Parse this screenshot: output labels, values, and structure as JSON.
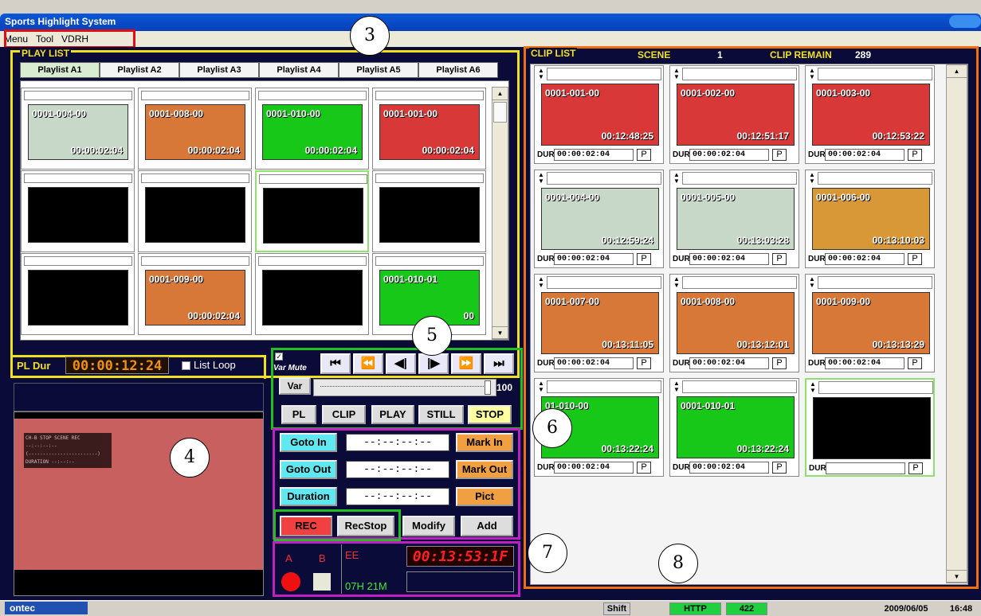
{
  "window": {
    "title": "Sports Highlight System"
  },
  "menu": [
    "Menu",
    "Tool",
    "VDRH"
  ],
  "callouts": [
    "3",
    "4",
    "5",
    "6",
    "7",
    "8"
  ],
  "playlist": {
    "label": "PLAY LIST",
    "tabs": [
      "Playlist A1",
      "Playlist A2",
      "Playlist A3",
      "Playlist A4",
      "Playlist A5",
      "Playlist A6"
    ],
    "cells": [
      {
        "id": "0001-004-00",
        "tc": "00:00:02:04",
        "color": "#c8d8c8"
      },
      {
        "id": "0001-008-00",
        "tc": "00:00:02:04",
        "color": "#d87838"
      },
      {
        "id": "0001-010-00",
        "tc": "00:00:02:04",
        "color": "#18c818"
      },
      {
        "id": "0001-001-00",
        "tc": "00:00:02:04",
        "color": "#d83838"
      },
      {
        "id": "",
        "tc": "",
        "color": "#000000"
      },
      {
        "id": "",
        "tc": "",
        "color": "#000000"
      },
      {
        "id": "",
        "tc": "",
        "color": "#000000"
      },
      {
        "id": "",
        "tc": "",
        "color": "#000000"
      },
      {
        "id": "",
        "tc": "",
        "color": "#000000"
      },
      {
        "id": "0001-009-00",
        "tc": "00:00:02:04",
        "color": "#d87838"
      },
      {
        "id": "",
        "tc": "",
        "color": "#000000"
      },
      {
        "id": "0001-010-01",
        "tc": "00",
        "color": "#18c818"
      }
    ],
    "pl_dur_label": "PL Dur",
    "pl_dur_value": "00:00:12:24",
    "list_loop_label": "List Loop"
  },
  "transport": {
    "var_mute": "Var Mute",
    "buttons": [
      "⏮",
      "⏪",
      "◀|",
      "|▶",
      "⏩",
      "⏭"
    ],
    "var_label": "Var",
    "speed": "100",
    "modes": [
      "PL",
      "CLIP",
      "PLAY",
      "STILL",
      "STOP"
    ]
  },
  "marks": {
    "goto_in": "Goto In",
    "goto_out": "Goto Out",
    "duration": "Duration",
    "tc_blank": "--:--:--:--",
    "mark_in": "Mark In",
    "mark_out": "Mark Out",
    "pict": "Pict",
    "rec": "REC",
    "rec_stop": "RecStop",
    "modify": "Modify",
    "add": "Add"
  },
  "recorder": {
    "a": "A",
    "b": "B",
    "ee": "EE",
    "remain": "07H 21M",
    "timecode": "00:13:53:1F"
  },
  "monitor": {
    "line1": "CH-B STOP   SCENE REC",
    "line2": "--:--:--:--",
    "line3": "(------------------------)",
    "line4": "DURATION    --:--:--"
  },
  "cliplist": {
    "label": "CLIP LIST",
    "scene_label": "SCENE",
    "scene_value": "1",
    "remain_label": "CLIP REMAIN",
    "remain_value": "289",
    "dur_label": "DUR",
    "p_label": "P",
    "clips": [
      {
        "id": "0001-001-00",
        "tc": "00:12:48:25",
        "dur": "00:00:02:04",
        "color": "#d83838"
      },
      {
        "id": "0001-002-00",
        "tc": "00:12:51:17",
        "dur": "00:00:02:04",
        "color": "#d83838"
      },
      {
        "id": "0001-003-00",
        "tc": "00:12:53:22",
        "dur": "00:00:02:04",
        "color": "#d83838"
      },
      {
        "id": "0001-004-00",
        "tc": "00:12:59:24",
        "dur": "00:00:02:04",
        "color": "#c8d8c8"
      },
      {
        "id": "0001-005-00",
        "tc": "00:13:03:28",
        "dur": "00:00:02:04",
        "color": "#c8d8c8"
      },
      {
        "id": "0001-006-00",
        "tc": "00:13:10:03",
        "dur": "00:00:02:04",
        "color": "#d89838"
      },
      {
        "id": "0001-007-00",
        "tc": "00:13:11:05",
        "dur": "00:00:02:04",
        "color": "#d87838"
      },
      {
        "id": "0001-008-00",
        "tc": "00:13:12:01",
        "dur": "00:00:02:04",
        "color": "#d87838"
      },
      {
        "id": "0001-009-00",
        "tc": "00:13:13:29",
        "dur": "00:00:02:04",
        "color": "#d87838"
      },
      {
        "id": "01-010-00",
        "tc": "00:13:22:24",
        "dur": "00:00:02:04",
        "color": "#18c818"
      },
      {
        "id": "0001-010-01",
        "tc": "00:13:22:24",
        "dur": "00:00:02:04",
        "color": "#18c818"
      },
      {
        "id": "",
        "tc": "",
        "dur": "",
        "color": "#000000"
      }
    ]
  },
  "status": {
    "logo": "ontec",
    "shift": "Shift",
    "http": "HTTP",
    "port": "422",
    "date": "2009/06/05",
    "time": "16:48"
  }
}
